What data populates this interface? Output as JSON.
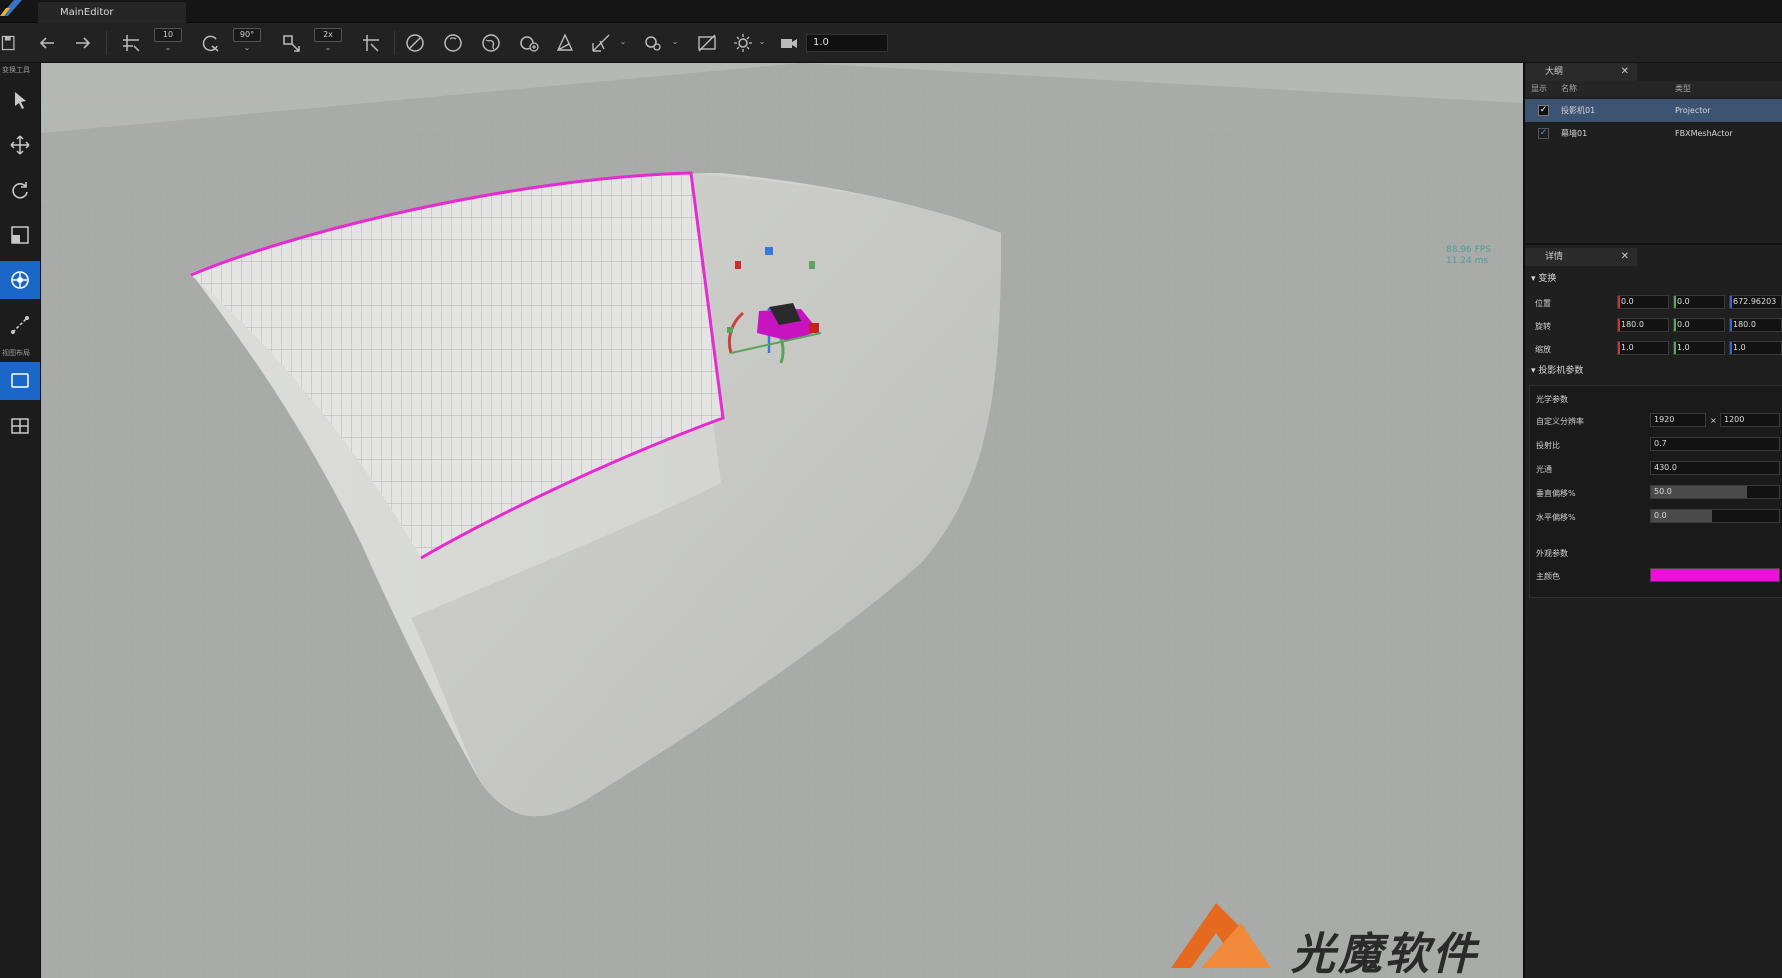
{
  "window": {
    "tab_title": "MainEditor"
  },
  "toolbar": {
    "move_snap": "10",
    "rotate_snap": "90°",
    "scale_snap": "2x",
    "camera_speed": "1.0"
  },
  "left_tools": {
    "section_transform": "变换工具",
    "section_view": "视图布局"
  },
  "viewport": {
    "stats_fps": "88.96 FPS",
    "stats_ms": "11.24 ms",
    "watermark": "光魔软件"
  },
  "outliner": {
    "tab": "大纲",
    "col_show": "显示",
    "col_name": "名称",
    "col_type": "类型",
    "items": [
      {
        "name": "投影机01",
        "type": "Projector",
        "checked": "✓"
      },
      {
        "name": "幕墙01",
        "type": "FBXMeshActor",
        "checked": "✓"
      }
    ]
  },
  "details": {
    "tab": "详情",
    "transform_section": "变换",
    "location_label": "位置",
    "location": [
      "0.0",
      "0.0",
      "672.96203"
    ],
    "rotation_label": "旋转",
    "rotation": [
      "180.0",
      "0.0",
      "180.0"
    ],
    "scale_label": "缩放",
    "scale": [
      "1.0",
      "1.0",
      "1.0"
    ],
    "projector_section": "投影机参数",
    "optics_section": "光学参数",
    "resolution_label": "自定义分辨率",
    "resolution_w": "1920",
    "resolution_x": "×",
    "resolution_h": "1200",
    "throw_ratio_label": "投射比",
    "throw_ratio": "0.7",
    "lumens_label": "光通",
    "lumens": "430.0",
    "vshift_label": "垂直偏移%",
    "vshift": "50.0",
    "vshift_fraction": 0.75,
    "hshift_label": "水平偏移%",
    "hshift": "0.0",
    "hshift_fraction": 0.48,
    "appearance_section": "外观参数",
    "color_label": "主颜色",
    "main_color": "#ee10d6"
  },
  "colors": {
    "accent": "#1a67c8",
    "selection": "#3c5372",
    "highlight": "#e62bd0"
  }
}
